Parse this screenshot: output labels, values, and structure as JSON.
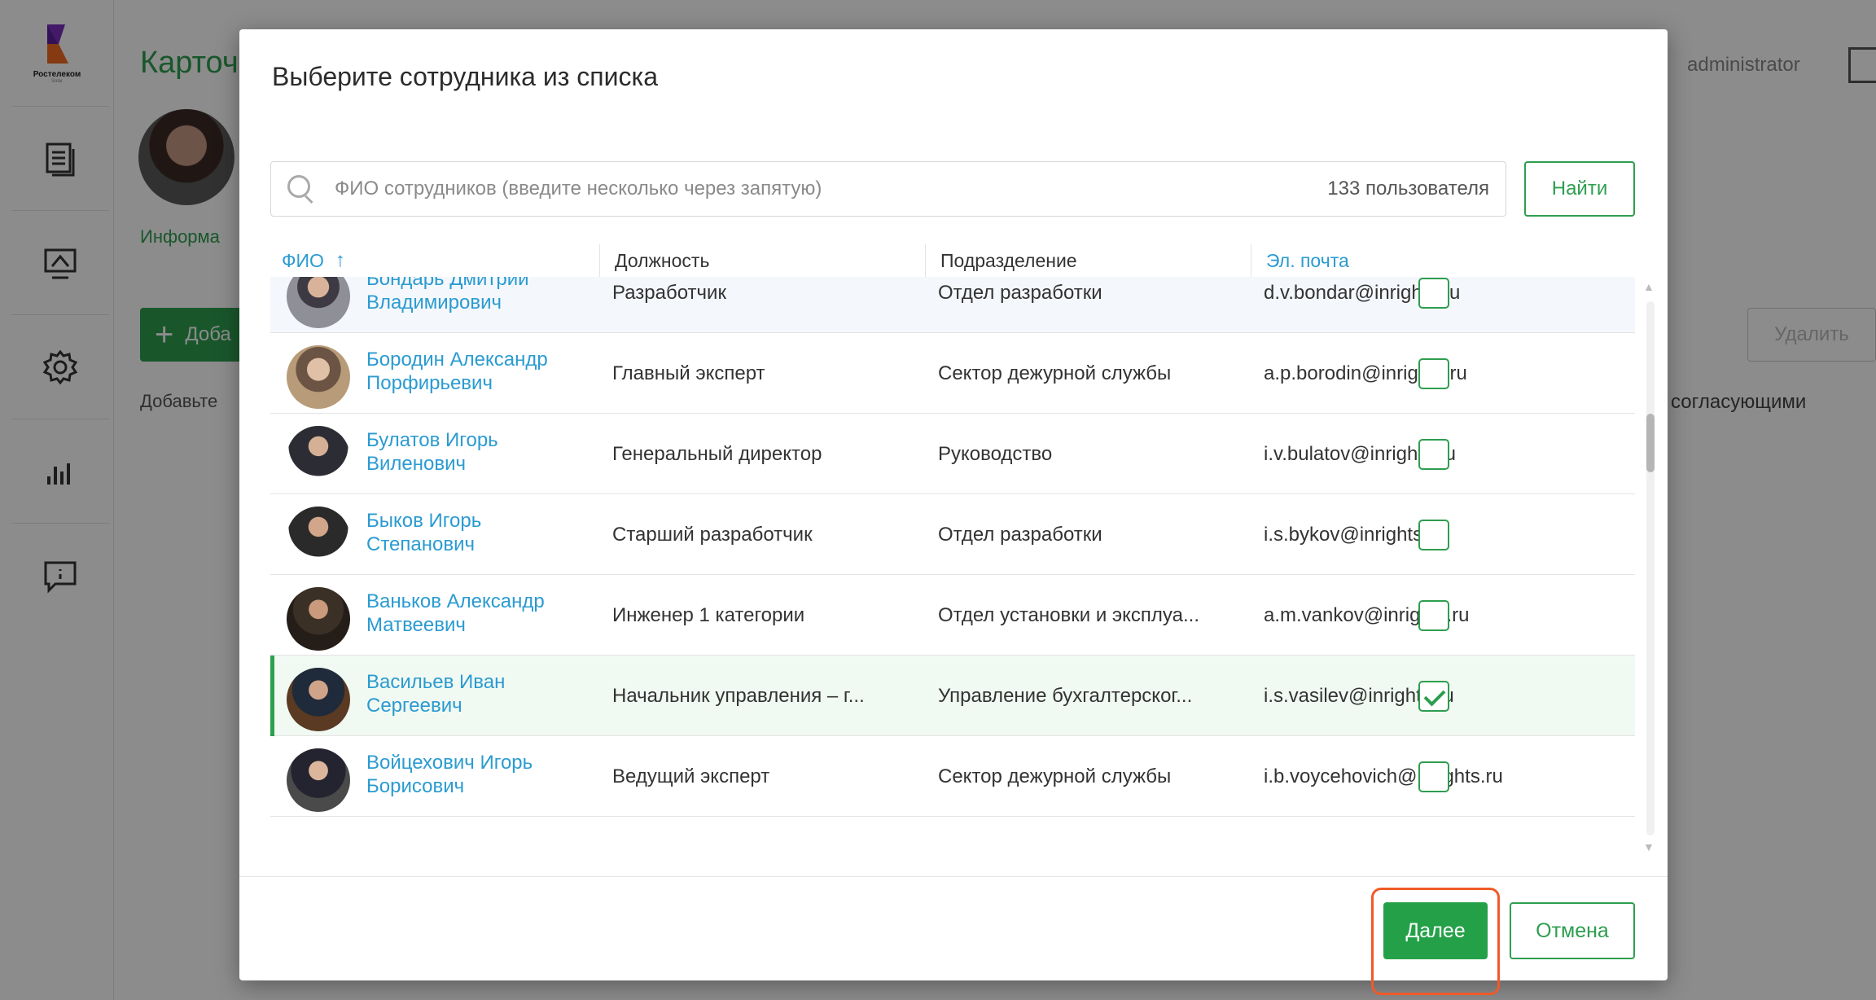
{
  "app": {
    "logo_text": "Ростелеком",
    "logo_subtext": "Solar",
    "page_title": "Карточ",
    "info_tab": "Информа",
    "add_button": "Доба",
    "hint_text": "Добавьте",
    "user_name": "administrator",
    "delete_button": "Удалить",
    "right_hint": "согласующими",
    "nav": [
      "document-list-icon",
      "monitor-icon",
      "gear-icon",
      "bar-chart-icon",
      "feedback-icon"
    ]
  },
  "modal": {
    "title": "Выберите сотрудника из списка",
    "search": {
      "placeholder": "ФИО сотрудников (введите несколько через запятую)",
      "count": "133 пользователя",
      "find_button": "Найти"
    },
    "columns": {
      "name": "ФИО",
      "position": "Должность",
      "department": "Подразделение",
      "email": "Эл. почта"
    },
    "rows": [
      {
        "name": "Бондарь Дмитрий Владимирович",
        "position": "Разработчик",
        "department": "Отдел разработки",
        "email": "d.v.bondar@inrights.ru",
        "checked": false
      },
      {
        "name": "Бородин Александр Порфирьевич",
        "position": "Главный эксперт",
        "department": "Сектор дежурной службы",
        "email": "a.p.borodin@inrights.ru",
        "checked": false
      },
      {
        "name": "Булатов Игорь Виленович",
        "position": "Генеральный директор",
        "department": "Руководство",
        "email": "i.v.bulatov@inrights.ru",
        "checked": false
      },
      {
        "name": "Быков Игорь Степанович",
        "position": "Старший разработчик",
        "department": "Отдел разработки",
        "email": "i.s.bykov@inrights.ru",
        "checked": false
      },
      {
        "name": "Ваньков Александр Матвеевич",
        "position": "Инженер 1 категории",
        "department": "Отдел установки и эксплуа...",
        "email": "a.m.vankov@inrights.ru",
        "checked": false
      },
      {
        "name": "Васильев Иван Сергеевич",
        "position": "Начальник управления – г...",
        "department": "Управление бухгалтерског...",
        "email": "i.s.vasilev@inrights.ru",
        "checked": true
      },
      {
        "name": "Войцехович Игорь Борисович",
        "position": "Ведущий эксперт",
        "department": "Сектор дежурной службы",
        "email": "i.b.voycehovich@inrights.ru",
        "checked": false
      }
    ],
    "next_button": "Далее",
    "cancel_button": "Отмена"
  },
  "colors": {
    "accent_green": "#2e9e4f",
    "link_blue": "#2a9bd1",
    "highlight_orange": "#f05a28"
  }
}
